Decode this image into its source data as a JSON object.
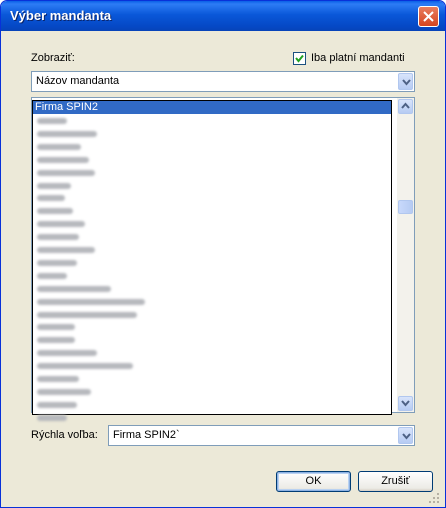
{
  "window": {
    "title": "Výber mandanta"
  },
  "filter": {
    "show_label": "Zobraziť:",
    "only_valid_label": "Iba platní mandanti",
    "only_valid_checked": true,
    "sort_value": "Názov mandanta"
  },
  "list": {
    "selected_item": "Firma SPIN2",
    "blurred_rows_visible": 24
  },
  "quick": {
    "label": "Rýchla voľba:",
    "value": "Firma SPIN2`"
  },
  "buttons": {
    "ok": "OK",
    "cancel": "Zrušiť"
  },
  "colors": {
    "titlebar": "#0a58d9",
    "selection": "#316ac5",
    "dialog_bg": "#ece9d8"
  }
}
